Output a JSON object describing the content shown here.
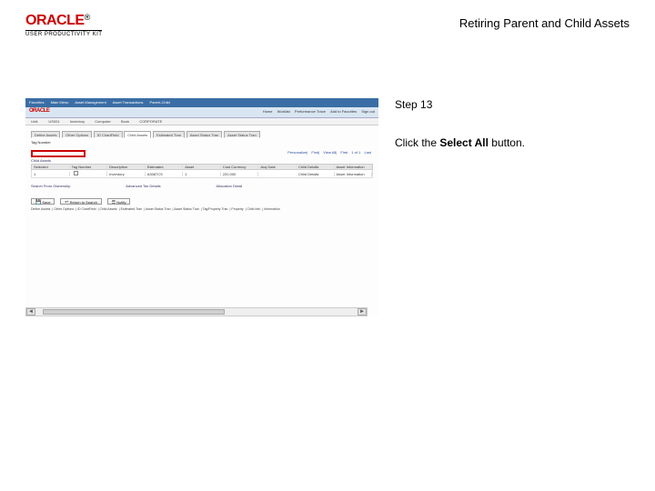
{
  "header": {
    "brand": "ORACLE",
    "tm": "®",
    "brand_sub": "USER PRODUCTIVITY KIT",
    "doc_title": "Retiring Parent and Child Assets"
  },
  "instructions": {
    "step": "Step 13",
    "text_pre": "Click the ",
    "text_bold": "Select All",
    "text_post": " button."
  },
  "screenshot": {
    "nav": {
      "items": [
        "Favorites",
        "Main Menu",
        "Asset Management",
        "Asset Transactions",
        "Parent-Child"
      ]
    },
    "bar": {
      "brand": "ORACLE",
      "right": [
        "Home",
        "Worklist",
        "Performance Trace",
        "Add to Favorites",
        "Sign out"
      ]
    },
    "subbar": {
      "unit_lbl": "Unit:",
      "unit_val": "US001",
      "inv_lbl": "Inventory",
      "inv_val": "Computer",
      "book_lbl": "Book",
      "book_val": "CORPORATE"
    },
    "tabs": [
      "Define Assets",
      "Other Options",
      "ID ChartField",
      "Child Assets",
      "Estimated Tran",
      "Asset Status Tran",
      "Asset Status Tran"
    ],
    "field_row": {
      "tag_lbl": "Tag Number"
    },
    "links": [
      "Personalize",
      "Find",
      "View All",
      "First",
      "1 of 1",
      "Last"
    ],
    "section": "Child Assets",
    "grid": {
      "headers": [
        "Selected",
        "Tag Number",
        "Description",
        "Estimated",
        "Asset",
        "Cost Currency",
        "Acq Date",
        "Child Details",
        "Asset Information"
      ],
      "row": [
        "1",
        "",
        "Inventory",
        "A3087CS",
        "1",
        "220.000",
        "",
        "Child Details",
        "Asset Information"
      ]
    },
    "midlinks": [
      "Search From Ownership",
      "Advanced Tax Details",
      "Allocation Detail"
    ],
    "buttons": [
      {
        "icon": "💾",
        "label": "Save"
      },
      {
        "icon": "↩",
        "label": "Return to Search"
      },
      {
        "icon": "☰",
        "label": "Notify"
      }
    ],
    "footer": [
      "Define Assets",
      "Other Options",
      "ID ChartField",
      "Child Assets",
      "Estimated Tran",
      "Asset Status Tran",
      "Asset Status Tran",
      "Tag/Property Tran",
      "Property",
      "Child Info",
      "Information"
    ]
  }
}
